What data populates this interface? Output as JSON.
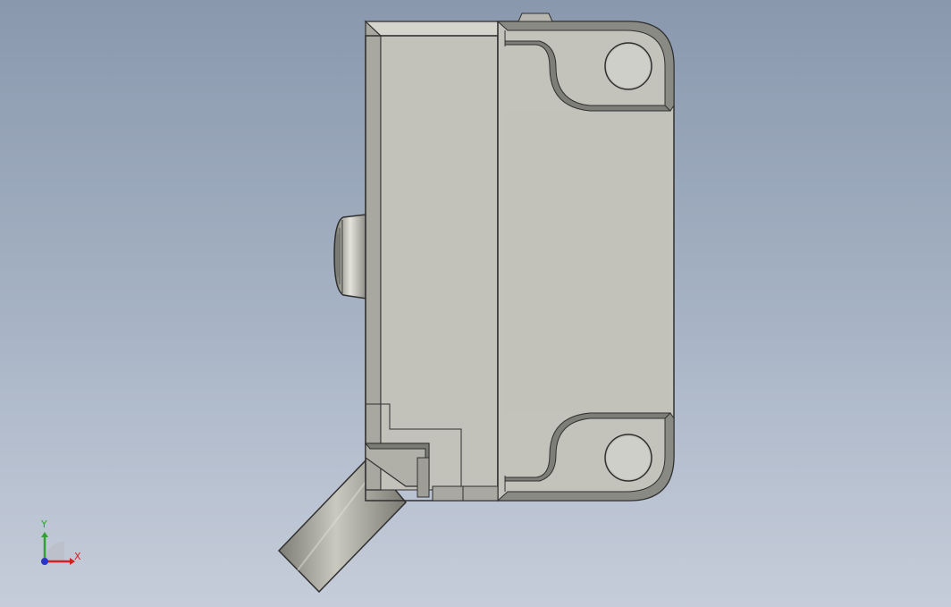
{
  "window": {
    "background_top": "#8a98ae",
    "background_bottom": "#c6cdda"
  },
  "model": {
    "body_color": "#c2c2bb",
    "body_shade": "#aeaea7",
    "edge_color": "#2f2f2f",
    "cable_color": "#a7a79e",
    "connector_color": "#b9b9b2"
  },
  "triad": {
    "x_label": "X",
    "y_label": "Y",
    "x_color": "#d42020",
    "y_color": "#2fa32f",
    "z_color": "#2b33c8"
  }
}
